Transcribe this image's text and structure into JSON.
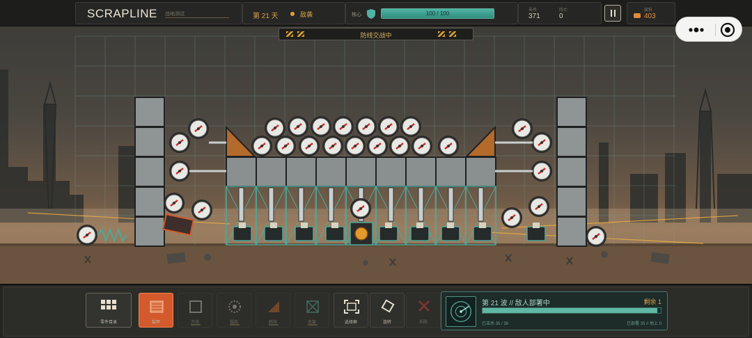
{
  "header": {
    "title": "SCRAPLINE",
    "subtitle": "战地测试",
    "day_label": "第 21 天",
    "enemy_status": "敌袭",
    "core_label": "核心",
    "core_value_text": "100 / 100",
    "core_fraction": 1.0,
    "stats": [
      {
        "caption": "击杀",
        "value": "371"
      },
      {
        "caption": "阵亡",
        "value": "0"
      }
    ],
    "resource_caption": "废料",
    "resource_value": "403"
  },
  "banner": {
    "text": "防线交战中"
  },
  "toolbar": {
    "catalog_label": "零件目录",
    "slots": [
      {
        "label": "装甲",
        "icon": "armor-plate-icon",
        "state": "selected"
      },
      {
        "label": "方块",
        "icon": "block-icon",
        "state": "disabled"
      },
      {
        "label": "锯齿",
        "icon": "saw-icon",
        "state": "disabled"
      },
      {
        "label": "斜块",
        "icon": "wedge-icon",
        "state": "disabled"
      },
      {
        "label": "支架",
        "icon": "strut-icon",
        "state": "disabled"
      },
      {
        "label": "选择框",
        "icon": "frame-select-icon",
        "state": "normal"
      },
      {
        "label": "旋转",
        "icon": "rotate-icon",
        "state": "normal"
      },
      {
        "label": "拆除",
        "icon": "delete-icon",
        "state": "disabled"
      }
    ]
  },
  "wave": {
    "title": "第 21 波 // 敌人部署中",
    "remaining": "剩余 1",
    "progress_fraction": 0.98,
    "left_note": "已击杀 35 / 36",
    "right_note": "已部署 35 // 地上 0"
  },
  "colors": {
    "accent_orange": "#d35a2c",
    "core_teal": "#4fb3a3",
    "warning_yellow": "#d8a032",
    "saw_red": "#d0302c"
  }
}
